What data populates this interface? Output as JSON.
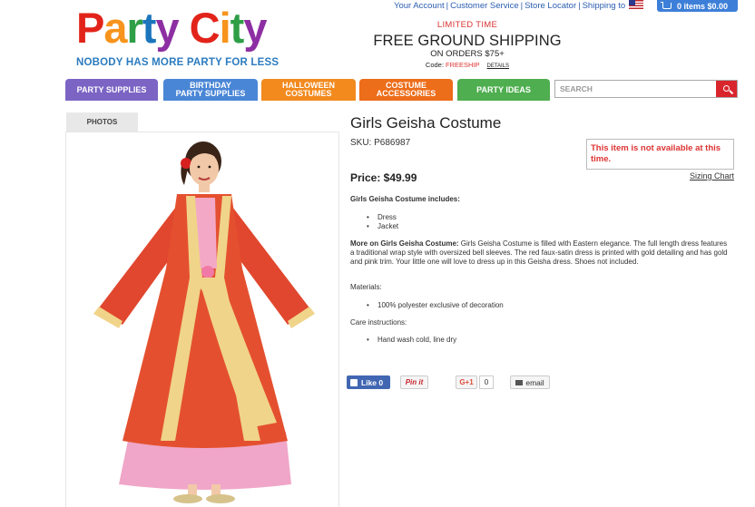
{
  "brand": {
    "logo_letters": [
      "P",
      "a",
      "r",
      "t",
      "y",
      " ",
      "C",
      "i",
      "t",
      "y"
    ],
    "logo_colors": [
      "#e2231a",
      "#f7941d",
      "#2e9e47",
      "#1b75bc",
      "#8d2fa3",
      "",
      "#e2231a",
      "#f7941d",
      "#2e9e47",
      "#8d2fa3"
    ],
    "tagline": "NOBODY HAS MORE PARTY FOR LESS"
  },
  "utility": {
    "your_account": "Your Account",
    "customer_service": "Customer Service",
    "store_locator": "Store Locator",
    "shipping_to": "Shipping to",
    "sep": "|"
  },
  "cart": {
    "label": "0 items $0.00"
  },
  "promo": {
    "limited": "LIMITED TIME",
    "headline": "FREE GROUND SHIPPING",
    "sub": "ON ORDERS $75+",
    "code_label": "Code:",
    "code": "FREESHIP",
    "details": "DETAILS"
  },
  "nav": {
    "party_supplies": "PARTY SUPPLIES",
    "birthday_l1": "BIRTHDAY",
    "birthday_l2": "PARTY SUPPLIES",
    "halloween_l1": "HALLOWEEN",
    "halloween_l2": "COSTUMES",
    "costume_l1": "COSTUME",
    "costume_l2": "ACCESSORIES",
    "party_ideas": "PARTY IDEAS",
    "colors": {
      "party_supplies": "#7b64c4",
      "birthday": "#4a86d6",
      "halloween": "#f28a1e",
      "costume": "#ec6d1a",
      "party_ideas": "#4fae4f"
    }
  },
  "search": {
    "placeholder": "SEARCH"
  },
  "photos": {
    "tab": "PHOTOS"
  },
  "product": {
    "title": "Girls Geisha Costume",
    "sku": "SKU: P686987",
    "unavailable": "This item is not available at this time.",
    "sizing": "Sizing Chart",
    "price": "Price: $49.99",
    "includes_heading": "Girls Geisha Costume includes:",
    "includes": [
      "Dress",
      "Jacket"
    ],
    "more_label": "More on Girls Geisha Costume:",
    "more_text": " Girls Geisha Costume is filled with Eastern elegance. The full length dress features a traditional wrap style with oversized bell sleeves. The red faux-satin dress is printed with gold detailing and has gold and pink trim. Your little one will love to dress up in this Geisha dress. Shoes not included.",
    "materials_heading": "Materials:",
    "materials": [
      "100% polyester exclusive of decoration"
    ],
    "care_heading": "Care instructions:",
    "care": [
      "Hand wash cold, line dry"
    ]
  },
  "social": {
    "like": "Like 0",
    "pin": "Pin it",
    "gplus": "G+1",
    "gplus_count": "0",
    "email": "email"
  }
}
